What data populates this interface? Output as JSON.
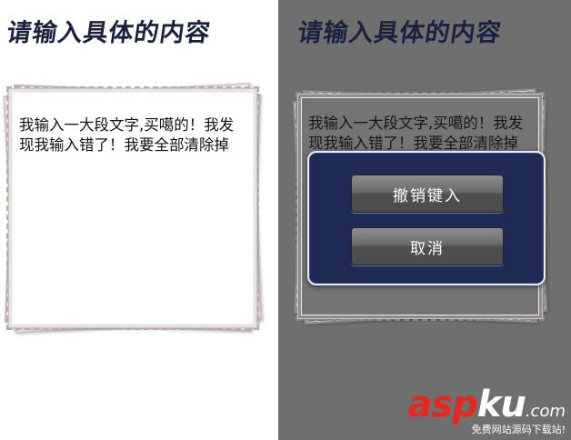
{
  "left_panel": {
    "heading": "请输入具体的内容",
    "input_text": "我输入一大段文字,买噶的！我发现我输入错了！我要全部清除掉"
  },
  "right_panel": {
    "heading": "请输入具体的内容",
    "input_text": "我输入一大段文字,买噶的！我发现我输入错了！我要全部清除掉",
    "dialog": {
      "undo_label": "撤销键入",
      "cancel_label": "取消"
    }
  },
  "watermark": {
    "asp": "asp",
    "ku": "ku",
    "com": ".com",
    "subtitle": "免费网站源码下载站!"
  },
  "colors": {
    "dim_overlay": "#6f6f6f",
    "dialog_bg": "#1f2b55",
    "heading": "#1a2140",
    "watermark_red": "#e9261c"
  }
}
